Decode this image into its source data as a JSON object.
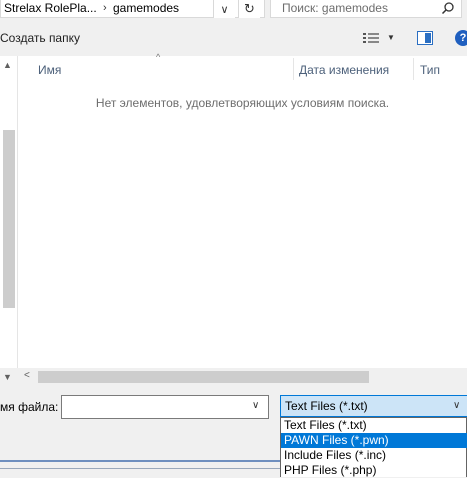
{
  "address": {
    "crumbs": [
      "Strelax RolePla...",
      "gamemodes"
    ],
    "separator": "›",
    "dropdown_glyph": "∨",
    "refresh_glyph": "↻"
  },
  "search": {
    "placeholder": "Поиск: gamemodes"
  },
  "toolbar": {
    "new_folder": "Создать папку",
    "help_glyph": "?"
  },
  "list": {
    "columns": [
      "Имя",
      "Дата изменения",
      "Тип"
    ],
    "empty_message": "Нет элементов, удовлетворяющих условиям поиска."
  },
  "bottom": {
    "filename_label": "мя файла:",
    "filename_value": "",
    "filter_selected": "Text Files (*.txt)",
    "filter_options": [
      {
        "label": "Text Files (*.txt)",
        "selected": false
      },
      {
        "label": "PAWN Files (*.pwn)",
        "selected": true
      },
      {
        "label": "Include Files (*.inc)",
        "selected": false
      },
      {
        "label": "PHP Files (*.php)",
        "selected": false
      }
    ]
  },
  "colors": {
    "accent": "#0078d7",
    "select_bg": "#cce4f7"
  }
}
